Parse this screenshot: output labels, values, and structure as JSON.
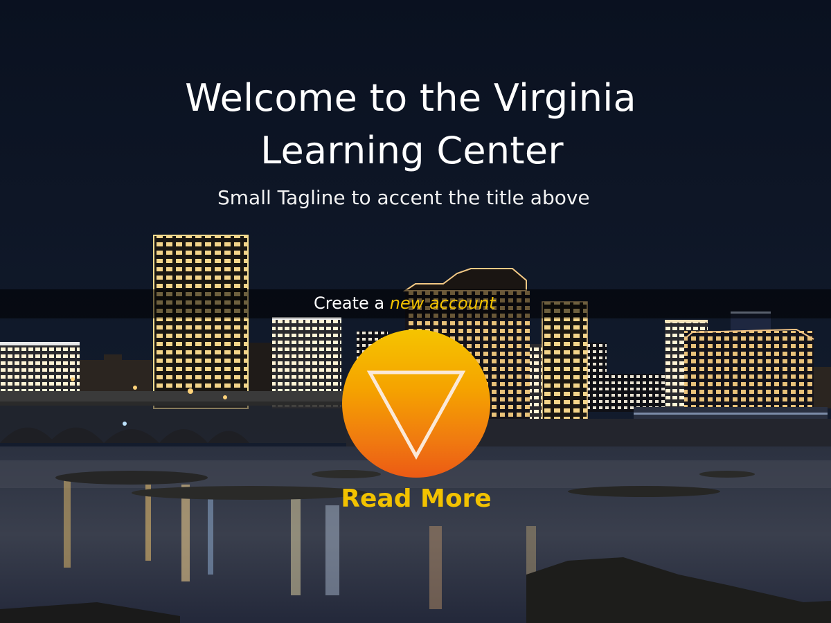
{
  "hero": {
    "title_line1": "Welcome to the Virginia",
    "title_line2": "Learning Center",
    "tagline": "Small Tagline to accent the title above"
  },
  "account": {
    "prefix": "Create a ",
    "link_label": "new account"
  },
  "read_more": {
    "icon": "down-triangle-icon",
    "label": "Read More"
  },
  "colors": {
    "accent": "#f2c200",
    "button_top": "#f5c400",
    "button_bottom": "#ec5a14",
    "sky": "#0b1120",
    "title_text": "#ffffff"
  },
  "background": {
    "scene": "night-city-skyline-river"
  }
}
